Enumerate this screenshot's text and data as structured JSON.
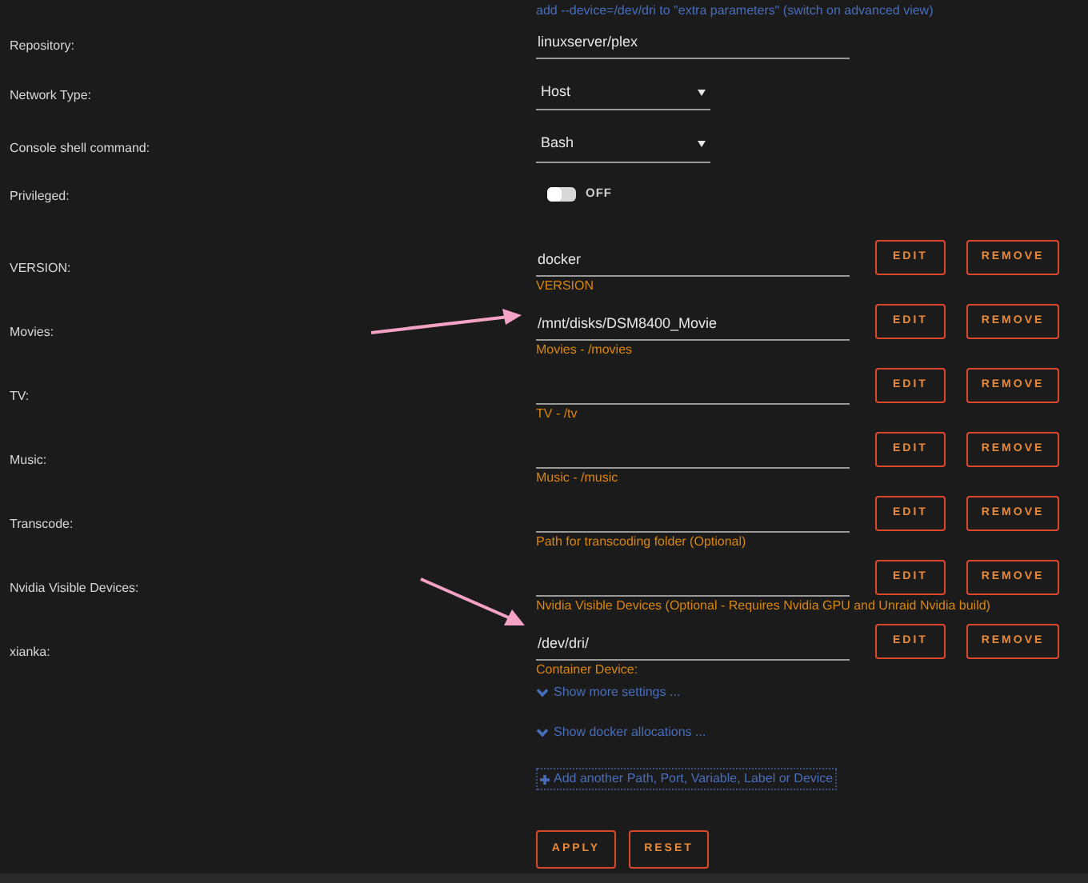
{
  "hint": "add --device=/dev/dri to \"extra parameters\" (switch on advanced view)",
  "settings": [
    {
      "kind": "text",
      "label": "Repository:",
      "value": "linuxserver/plex"
    },
    {
      "kind": "select",
      "label": "Network Type:",
      "value": "Host"
    },
    {
      "kind": "select",
      "label": "Console shell command:",
      "value": "Bash"
    },
    {
      "kind": "toggle",
      "label": "Privileged:",
      "on": false,
      "state_text": "OFF"
    }
  ],
  "mappings": [
    {
      "label": "VERSION:",
      "value": "docker",
      "description": "VERSION",
      "buttons": [
        "EDIT",
        "REMOVE"
      ]
    },
    {
      "label": "Movies:",
      "value": "/mnt/disks/DSM8400_Movie",
      "description": "Movies - /movies",
      "buttons": [
        "EDIT",
        "REMOVE"
      ]
    },
    {
      "label": "TV:",
      "description": "TV - /tv",
      "buttons": [
        "EDIT",
        "REMOVE"
      ]
    },
    {
      "label": "Music:",
      "description": "Music - /music",
      "buttons": [
        "EDIT",
        "REMOVE"
      ]
    },
    {
      "label": "Transcode:",
      "description": "Path for transcoding folder (Optional)",
      "buttons": [
        "EDIT",
        "REMOVE"
      ]
    },
    {
      "label": "Nvidia Visible Devices:",
      "description": "Nvidia Visible Devices (Optional - Requires Nvidia GPU and Unraid Nvidia build)",
      "buttons": [
        "EDIT",
        "REMOVE"
      ]
    },
    {
      "label": "xianka:",
      "value": "/dev/dri/",
      "description": "Container Device:",
      "buttons": [
        "EDIT",
        "REMOVE"
      ]
    }
  ],
  "show_more": {
    "label": "Show more settings ...",
    "expanded": false
  },
  "show_allocations": {
    "label": "Show docker allocations ...",
    "expanded": false
  },
  "add_link": "Add another Path, Port, Variable, Label or Device",
  "actions": [
    "APPLY",
    "RESET"
  ]
}
